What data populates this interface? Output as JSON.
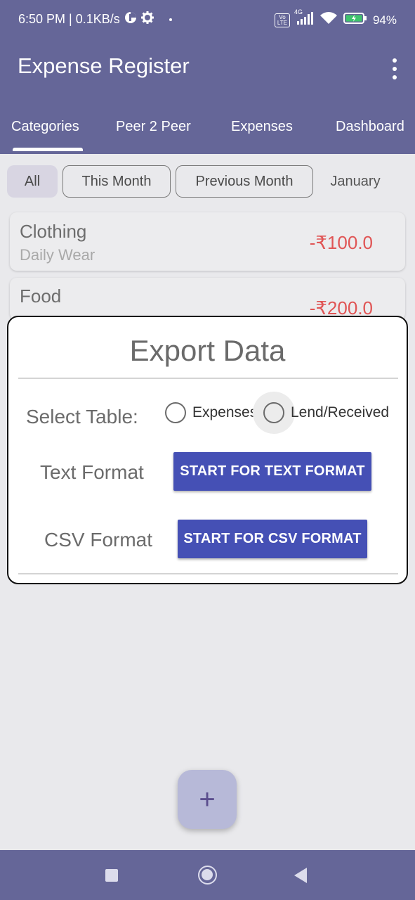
{
  "status_bar": {
    "time_speed": "6:50 PM | 0.1KB/s",
    "network_type": "4G",
    "volte": "Vo LTE",
    "battery": "94%"
  },
  "app_bar": {
    "title": "Expense Register",
    "overflow_icon": "more-vert-icon"
  },
  "tabs": [
    {
      "label": "Categories",
      "selected": true
    },
    {
      "label": "Peer 2 Peer"
    },
    {
      "label": "Expenses"
    },
    {
      "label": "Dashboard"
    }
  ],
  "filters": [
    {
      "label": "All",
      "selected": true
    },
    {
      "label": "This Month"
    },
    {
      "label": "Previous Month"
    },
    {
      "label": "January"
    }
  ],
  "categories": [
    {
      "title": "Clothing",
      "subtitle": "Daily Wear",
      "amount": "-₹100.0"
    },
    {
      "title": "Food",
      "amount": "-₹200.0"
    }
  ],
  "dialog": {
    "title": "Export Data",
    "select_table_label": "Select Table:",
    "radio_expenses": "Expenses",
    "radio_lend": "Lend/Received",
    "text_format_label": "Text Format",
    "text_button": "START FOR TEXT FORMAT",
    "csv_format_label": "CSV Format",
    "csv_button": "START FOR CSV FORMAT"
  },
  "fab": {
    "label": "+"
  },
  "colors": {
    "primary": "#656698",
    "button": "#4550b5",
    "negative_amount": "#e05555",
    "background": "#e9e9ec"
  }
}
